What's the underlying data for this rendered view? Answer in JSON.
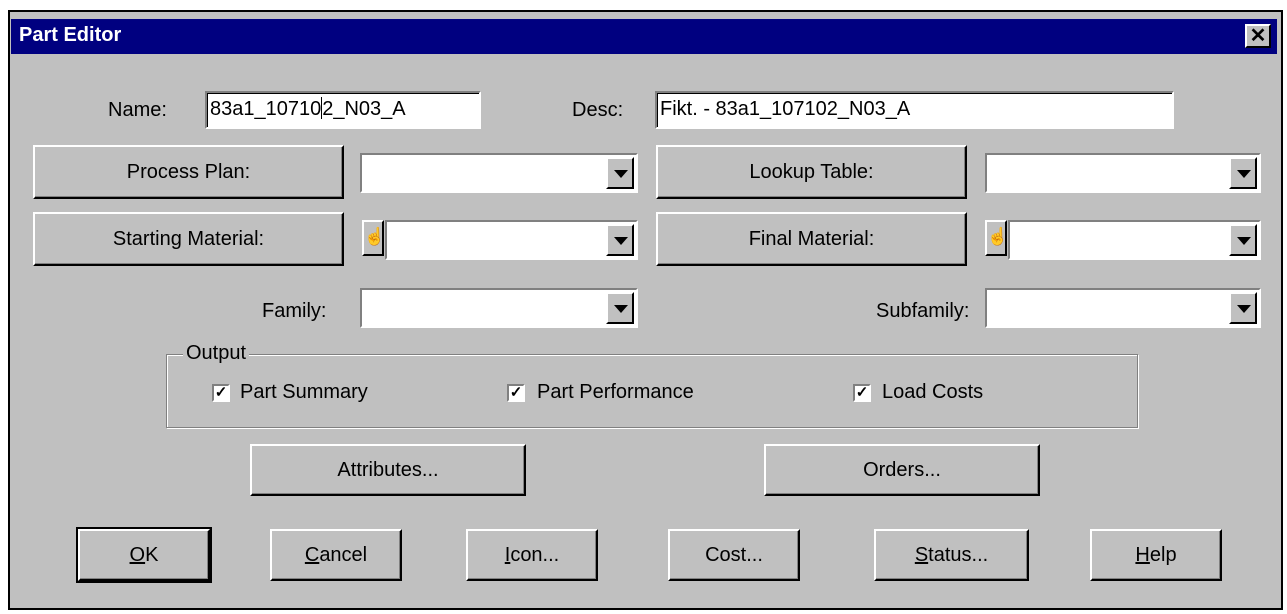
{
  "window": {
    "title": "Part Editor",
    "close_label": "✕"
  },
  "fields": {
    "name_label": "Name:",
    "name_value_before_caret": "83a1_10710",
    "name_value_after_caret": "2_N03_A",
    "desc_label": "Desc:",
    "desc_value": "Fikt. - 83a1_107102_N03_A"
  },
  "buttons": {
    "process_plan": "Process Plan:",
    "lookup_table": "Lookup Table:",
    "starting_material": "Starting Material:",
    "final_material": "Final Material:",
    "attributes": "Attributes...",
    "orders": "Orders..."
  },
  "combos": {
    "process_plan": "",
    "lookup_table": "",
    "starting_material": "",
    "final_material": "",
    "family": "",
    "subfamily": ""
  },
  "labels": {
    "family": "Family:",
    "subfamily": "Subfamily:"
  },
  "output": {
    "group_label": "Output",
    "part_summary": {
      "label": "Part Summary",
      "checked": true
    },
    "part_performance": {
      "label": "Part Performance",
      "checked": true
    },
    "load_costs": {
      "label": "Load Costs",
      "checked": true
    },
    "check_glyph": "✓"
  },
  "footer": {
    "ok_mnemonic": "O",
    "ok_rest": "K",
    "cancel_mnemonic": "C",
    "cancel_rest": "ancel",
    "icon_mnemonic": "I",
    "icon_rest": "con...",
    "cost_label": "Cost...",
    "status_mnemonic": "S",
    "status_rest": "tatus...",
    "help_mnemonic": "H",
    "help_rest": "elp"
  },
  "icons": {
    "hand_glyph": "☝"
  }
}
